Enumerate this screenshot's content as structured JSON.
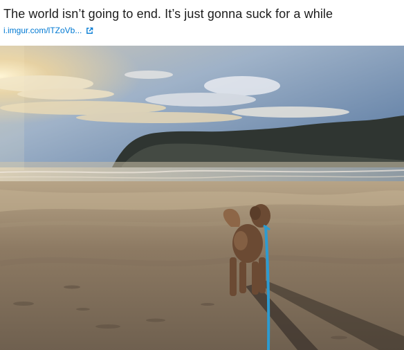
{
  "post": {
    "title": "The world isn’t going to end. It’s just gonna suck for a while",
    "link_text": "i.imgur.com/lTZoVb...",
    "link_icon": "external-link-icon",
    "image_description_icon": "beach-dog-photo",
    "colors": {
      "title": "#1c1c1c",
      "link": "#0079d3",
      "leash": "#2c9bd1"
    }
  }
}
